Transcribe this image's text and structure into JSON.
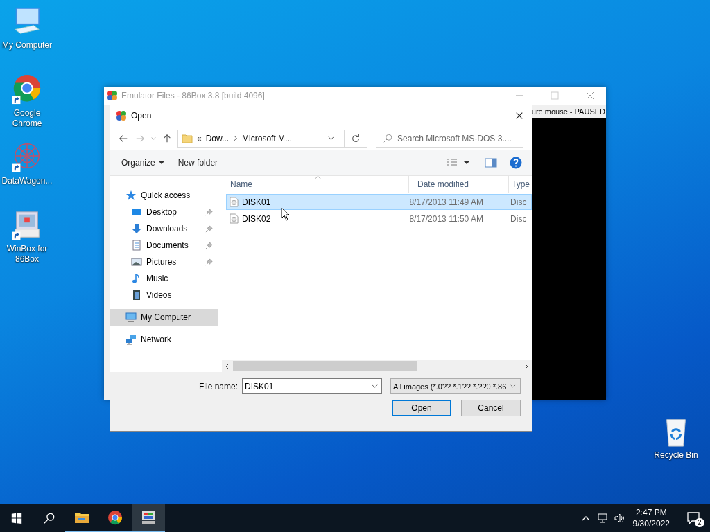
{
  "desktop": {
    "icons": [
      {
        "label": "My Computer",
        "kind": "computer",
        "shortcut": false
      },
      {
        "label": "Google Chrome",
        "kind": "chrome",
        "shortcut": true
      },
      {
        "label": "DataWagon...",
        "kind": "mandala",
        "shortcut": true
      },
      {
        "label": "WinBox for 86Box",
        "kind": "winbox",
        "shortcut": true
      }
    ],
    "recycle_bin": {
      "label": "Recycle Bin"
    }
  },
  "emulator_window": {
    "title": "Emulator Files - 86Box 3.8 [build 4096]",
    "status": "ure mouse - PAUSED"
  },
  "dialog": {
    "title": "Open",
    "address": {
      "overflow": "«",
      "segments": [
        "Dow...",
        "Microsoft M..."
      ]
    },
    "search": {
      "placeholder": "Search Microsoft MS-DOS 3...."
    },
    "toolbar": {
      "organize": "Organize",
      "new_folder": "New folder"
    },
    "nav": [
      {
        "label": "Quick access",
        "kind": "star",
        "selected": false,
        "children": [
          {
            "label": "Desktop",
            "kind": "desktop",
            "pinned": true,
            "selected": false
          },
          {
            "label": "Downloads",
            "kind": "downloads",
            "pinned": true,
            "selected": false
          },
          {
            "label": "Documents",
            "kind": "documents",
            "pinned": true,
            "selected": false
          },
          {
            "label": "Pictures",
            "kind": "pictures",
            "pinned": true,
            "selected": false
          },
          {
            "label": "Music",
            "kind": "music",
            "pinned": false,
            "selected": false
          },
          {
            "label": "Videos",
            "kind": "videos",
            "pinned": false,
            "selected": false
          }
        ]
      },
      {
        "label": "My Computer",
        "kind": "computer",
        "selected": true
      },
      {
        "label": "Network",
        "kind": "network",
        "selected": false
      }
    ],
    "columns": [
      "Name",
      "Date modified",
      "Type"
    ],
    "files": [
      {
        "name": "DISK01",
        "date": "8/17/2013 11:49 AM",
        "type": "Disc",
        "selected": true
      },
      {
        "name": "DISK02",
        "date": "8/17/2013 11:50 AM",
        "type": "Disc",
        "selected": false
      }
    ],
    "file_name": {
      "label": "File name:",
      "value": "DISK01"
    },
    "filter": "All images (*.0?? *.1?? *.??0 *.86",
    "buttons": [
      {
        "label": "Open",
        "default": true
      },
      {
        "label": "Cancel",
        "default": false
      }
    ]
  },
  "taskbar": {
    "apps": [
      {
        "kind": "explorer",
        "running": true,
        "selected": false
      },
      {
        "kind": "chrome",
        "running": true,
        "selected": false
      },
      {
        "kind": "emulator",
        "running": true,
        "selected": true
      }
    ],
    "time": "2:47 PM",
    "date": "9/30/2022",
    "notifications": "2"
  }
}
